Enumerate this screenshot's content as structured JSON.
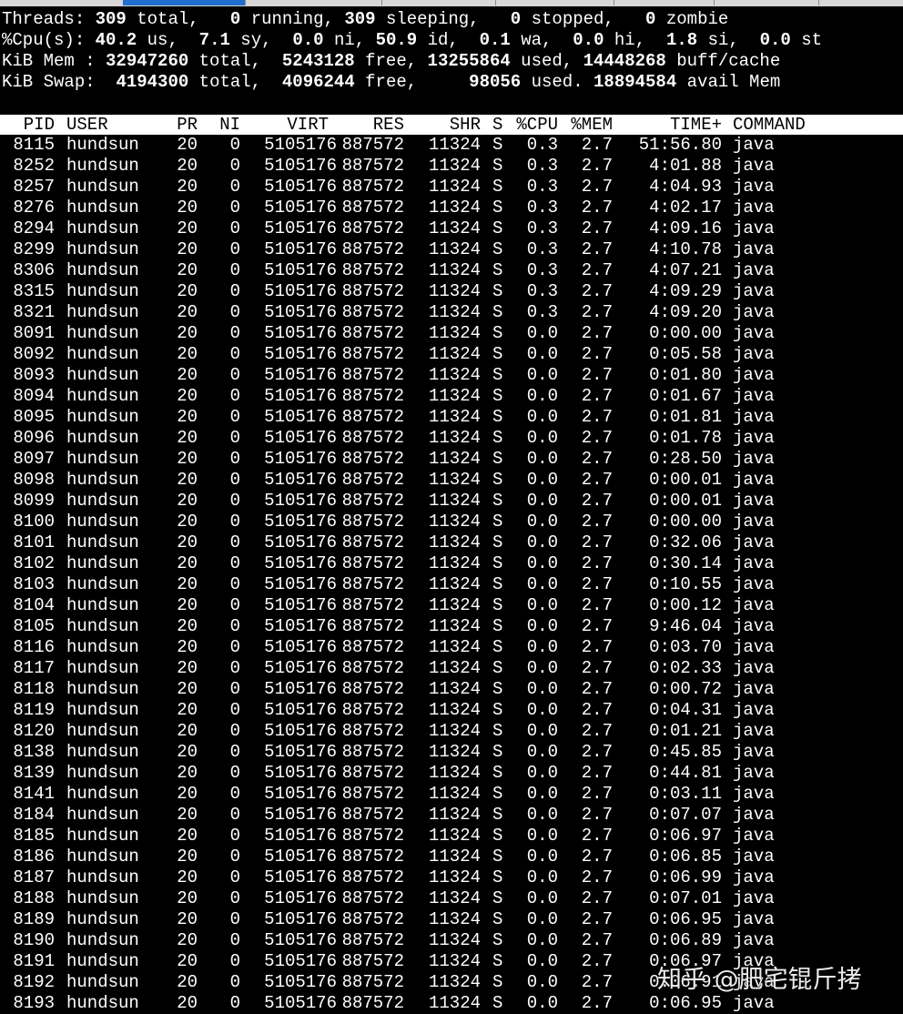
{
  "summary": {
    "threads": {
      "label": "Threads:",
      "total": "309",
      "total_label": "total,",
      "running": "0",
      "running_label": "running,",
      "sleeping": "309",
      "sleeping_label": "sleeping,",
      "stopped": "0",
      "stopped_label": "stopped,",
      "zombie": "0",
      "zombie_label": "zombie"
    },
    "cpu": {
      "label": "%Cpu(s):",
      "us": "40.2",
      "us_label": "us,",
      "sy": "7.1",
      "sy_label": "sy,",
      "ni": "0.0",
      "ni_label": "ni,",
      "id": "50.9",
      "id_label": "id,",
      "wa": "0.1",
      "wa_label": "wa,",
      "hi": "0.0",
      "hi_label": "hi,",
      "si": "1.8",
      "si_label": "si,",
      "st": "0.0",
      "st_label": "st"
    },
    "mem": {
      "label": "KiB Mem :",
      "total": "32947260",
      "total_label": "total,",
      "free": "5243128",
      "free_label": "free,",
      "used": "13255864",
      "used_label": "used,",
      "buff_cache": "14448268",
      "buff_cache_label": "buff/cache"
    },
    "swap": {
      "label": "KiB Swap:",
      "total": "4194300",
      "total_label": "total,",
      "free": "4096244",
      "free_label": "free,",
      "used": "98056",
      "used_label": "used.",
      "avail": "18894584",
      "avail_label": "avail Mem"
    }
  },
  "columns": [
    "PID",
    "USER",
    "PR",
    "NI",
    "VIRT",
    "RES",
    "SHR",
    "S",
    "%CPU",
    "%MEM",
    "TIME+",
    "COMMAND"
  ],
  "rows": [
    [
      "8115",
      "hundsun",
      "20",
      "0",
      "5105176",
      "887572",
      "11324",
      "S",
      "0.3",
      "2.7",
      "51:56.80",
      "java"
    ],
    [
      "8252",
      "hundsun",
      "20",
      "0",
      "5105176",
      "887572",
      "11324",
      "S",
      "0.3",
      "2.7",
      "4:01.88",
      "java"
    ],
    [
      "8257",
      "hundsun",
      "20",
      "0",
      "5105176",
      "887572",
      "11324",
      "S",
      "0.3",
      "2.7",
      "4:04.93",
      "java"
    ],
    [
      "8276",
      "hundsun",
      "20",
      "0",
      "5105176",
      "887572",
      "11324",
      "S",
      "0.3",
      "2.7",
      "4:02.17",
      "java"
    ],
    [
      "8294",
      "hundsun",
      "20",
      "0",
      "5105176",
      "887572",
      "11324",
      "S",
      "0.3",
      "2.7",
      "4:09.16",
      "java"
    ],
    [
      "8299",
      "hundsun",
      "20",
      "0",
      "5105176",
      "887572",
      "11324",
      "S",
      "0.3",
      "2.7",
      "4:10.78",
      "java"
    ],
    [
      "8306",
      "hundsun",
      "20",
      "0",
      "5105176",
      "887572",
      "11324",
      "S",
      "0.3",
      "2.7",
      "4:07.21",
      "java"
    ],
    [
      "8315",
      "hundsun",
      "20",
      "0",
      "5105176",
      "887572",
      "11324",
      "S",
      "0.3",
      "2.7",
      "4:09.29",
      "java"
    ],
    [
      "8321",
      "hundsun",
      "20",
      "0",
      "5105176",
      "887572",
      "11324",
      "S",
      "0.3",
      "2.7",
      "4:09.20",
      "java"
    ],
    [
      "8091",
      "hundsun",
      "20",
      "0",
      "5105176",
      "887572",
      "11324",
      "S",
      "0.0",
      "2.7",
      "0:00.00",
      "java"
    ],
    [
      "8092",
      "hundsun",
      "20",
      "0",
      "5105176",
      "887572",
      "11324",
      "S",
      "0.0",
      "2.7",
      "0:05.58",
      "java"
    ],
    [
      "8093",
      "hundsun",
      "20",
      "0",
      "5105176",
      "887572",
      "11324",
      "S",
      "0.0",
      "2.7",
      "0:01.80",
      "java"
    ],
    [
      "8094",
      "hundsun",
      "20",
      "0",
      "5105176",
      "887572",
      "11324",
      "S",
      "0.0",
      "2.7",
      "0:01.67",
      "java"
    ],
    [
      "8095",
      "hundsun",
      "20",
      "0",
      "5105176",
      "887572",
      "11324",
      "S",
      "0.0",
      "2.7",
      "0:01.81",
      "java"
    ],
    [
      "8096",
      "hundsun",
      "20",
      "0",
      "5105176",
      "887572",
      "11324",
      "S",
      "0.0",
      "2.7",
      "0:01.78",
      "java"
    ],
    [
      "8097",
      "hundsun",
      "20",
      "0",
      "5105176",
      "887572",
      "11324",
      "S",
      "0.0",
      "2.7",
      "0:28.50",
      "java"
    ],
    [
      "8098",
      "hundsun",
      "20",
      "0",
      "5105176",
      "887572",
      "11324",
      "S",
      "0.0",
      "2.7",
      "0:00.01",
      "java"
    ],
    [
      "8099",
      "hundsun",
      "20",
      "0",
      "5105176",
      "887572",
      "11324",
      "S",
      "0.0",
      "2.7",
      "0:00.01",
      "java"
    ],
    [
      "8100",
      "hundsun",
      "20",
      "0",
      "5105176",
      "887572",
      "11324",
      "S",
      "0.0",
      "2.7",
      "0:00.00",
      "java"
    ],
    [
      "8101",
      "hundsun",
      "20",
      "0",
      "5105176",
      "887572",
      "11324",
      "S",
      "0.0",
      "2.7",
      "0:32.06",
      "java"
    ],
    [
      "8102",
      "hundsun",
      "20",
      "0",
      "5105176",
      "887572",
      "11324",
      "S",
      "0.0",
      "2.7",
      "0:30.14",
      "java"
    ],
    [
      "8103",
      "hundsun",
      "20",
      "0",
      "5105176",
      "887572",
      "11324",
      "S",
      "0.0",
      "2.7",
      "0:10.55",
      "java"
    ],
    [
      "8104",
      "hundsun",
      "20",
      "0",
      "5105176",
      "887572",
      "11324",
      "S",
      "0.0",
      "2.7",
      "0:00.12",
      "java"
    ],
    [
      "8105",
      "hundsun",
      "20",
      "0",
      "5105176",
      "887572",
      "11324",
      "S",
      "0.0",
      "2.7",
      "9:46.04",
      "java"
    ],
    [
      "8116",
      "hundsun",
      "20",
      "0",
      "5105176",
      "887572",
      "11324",
      "S",
      "0.0",
      "2.7",
      "0:03.70",
      "java"
    ],
    [
      "8117",
      "hundsun",
      "20",
      "0",
      "5105176",
      "887572",
      "11324",
      "S",
      "0.0",
      "2.7",
      "0:02.33",
      "java"
    ],
    [
      "8118",
      "hundsun",
      "20",
      "0",
      "5105176",
      "887572",
      "11324",
      "S",
      "0.0",
      "2.7",
      "0:00.72",
      "java"
    ],
    [
      "8119",
      "hundsun",
      "20",
      "0",
      "5105176",
      "887572",
      "11324",
      "S",
      "0.0",
      "2.7",
      "0:04.31",
      "java"
    ],
    [
      "8120",
      "hundsun",
      "20",
      "0",
      "5105176",
      "887572",
      "11324",
      "S",
      "0.0",
      "2.7",
      "0:01.21",
      "java"
    ],
    [
      "8138",
      "hundsun",
      "20",
      "0",
      "5105176",
      "887572",
      "11324",
      "S",
      "0.0",
      "2.7",
      "0:45.85",
      "java"
    ],
    [
      "8139",
      "hundsun",
      "20",
      "0",
      "5105176",
      "887572",
      "11324",
      "S",
      "0.0",
      "2.7",
      "0:44.81",
      "java"
    ],
    [
      "8141",
      "hundsun",
      "20",
      "0",
      "5105176",
      "887572",
      "11324",
      "S",
      "0.0",
      "2.7",
      "0:03.11",
      "java"
    ],
    [
      "8184",
      "hundsun",
      "20",
      "0",
      "5105176",
      "887572",
      "11324",
      "S",
      "0.0",
      "2.7",
      "0:07.07",
      "java"
    ],
    [
      "8185",
      "hundsun",
      "20",
      "0",
      "5105176",
      "887572",
      "11324",
      "S",
      "0.0",
      "2.7",
      "0:06.97",
      "java"
    ],
    [
      "8186",
      "hundsun",
      "20",
      "0",
      "5105176",
      "887572",
      "11324",
      "S",
      "0.0",
      "2.7",
      "0:06.85",
      "java"
    ],
    [
      "8187",
      "hundsun",
      "20",
      "0",
      "5105176",
      "887572",
      "11324",
      "S",
      "0.0",
      "2.7",
      "0:06.99",
      "java"
    ],
    [
      "8188",
      "hundsun",
      "20",
      "0",
      "5105176",
      "887572",
      "11324",
      "S",
      "0.0",
      "2.7",
      "0:07.01",
      "java"
    ],
    [
      "8189",
      "hundsun",
      "20",
      "0",
      "5105176",
      "887572",
      "11324",
      "S",
      "0.0",
      "2.7",
      "0:06.95",
      "java"
    ],
    [
      "8190",
      "hundsun",
      "20",
      "0",
      "5105176",
      "887572",
      "11324",
      "S",
      "0.0",
      "2.7",
      "0:06.89",
      "java"
    ],
    [
      "8191",
      "hundsun",
      "20",
      "0",
      "5105176",
      "887572",
      "11324",
      "S",
      "0.0",
      "2.7",
      "0:06.97",
      "java"
    ],
    [
      "8192",
      "hundsun",
      "20",
      "0",
      "5105176",
      "887572",
      "11324",
      "S",
      "0.0",
      "2.7",
      "0:06.91",
      "java"
    ],
    [
      "8193",
      "hundsun",
      "20",
      "0",
      "5105176",
      "887572",
      "11324",
      "S",
      "0.0",
      "2.7",
      "0:06.95",
      "java"
    ]
  ],
  "watermark": "知乎 @肥宅锟斤拷",
  "colors": {
    "background": "#000000",
    "text": "#ffffff",
    "header_bg": "#ffffff",
    "header_text": "#000000",
    "active_tab": "#1e6fd0"
  }
}
